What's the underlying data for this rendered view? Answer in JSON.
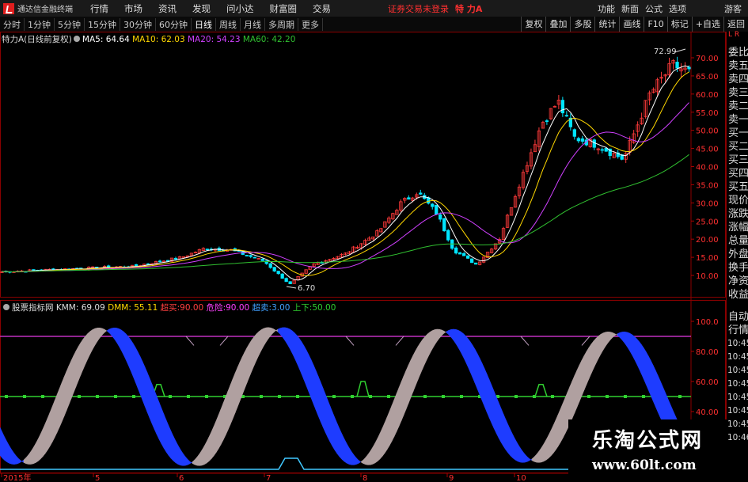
{
  "menubar": {
    "app_name": "通达信金融终端",
    "items": [
      "行情",
      "市场",
      "资讯",
      "发现",
      "问小达",
      "财富圈",
      "交易"
    ],
    "login_status": "证券交易未登录",
    "stock_name": "特 力A",
    "right_items": [
      "功能",
      "新面",
      "公式",
      "选项",
      "游客"
    ]
  },
  "periodbar": {
    "periods": [
      "分时",
      "1分钟",
      "5分钟",
      "15分钟",
      "30分钟",
      "60分钟",
      "日线",
      "周线",
      "月线",
      "多周期",
      "更多"
    ],
    "active": "日线",
    "tools": [
      "复权",
      "叠加",
      "多股",
      "统计",
      "画线",
      "F10",
      "标记",
      "+自选",
      "返回"
    ]
  },
  "legend_main": {
    "title": "特力A(日线前复权)",
    "ma5": "MA5: 64.64",
    "ma10": "MA10: 62.03",
    "ma20": "MA20: 54.23",
    "ma60": "MA60: 42.20"
  },
  "legend_ind": {
    "title": "股票指标网",
    "kmm": "KMM: 69.09",
    "dmm": "DMM: 55.11",
    "chaomai": "超买:",
    "chaomai_v": "90.00",
    "weixian": "危险:",
    "weixian_v": "90.00",
    "chaomai2": "超卖:",
    "chaomai2_v": "3.00",
    "shangxia": "上下:",
    "shangxia_v": "50.00"
  },
  "annotations": {
    "high": "72.99",
    "low": "6.70"
  },
  "price_axis": [
    "70.00",
    "65.00",
    "60.00",
    "55.00",
    "50.00",
    "45.00",
    "40.00",
    "35.00",
    "30.00",
    "25.00",
    "20.00",
    "15.00",
    "10.00"
  ],
  "ind_axis": [
    "100.0",
    "80.00",
    "60.00",
    "40.00"
  ],
  "date_axis": [
    "2015年",
    "5",
    "6",
    "7",
    "8",
    "9",
    "10"
  ],
  "right_panel": {
    "top": "L R",
    "items": [
      "委比",
      "卖五",
      "卖四",
      "卖三",
      "卖二",
      "卖一",
      "买一",
      "买二",
      "买三",
      "买四",
      "买五",
      "现价",
      "涨跌",
      "涨幅",
      "总量",
      "外盘",
      "换手",
      "净资",
      "收益",
      "自动",
      "行情"
    ],
    "times": [
      "10:45",
      "10:45",
      "10:45",
      "10:45",
      "10:45",
      "10:45",
      "10:45",
      "10:46"
    ]
  },
  "watermark": {
    "line1": "乐淘公式网",
    "line2": "www.60lt.com"
  },
  "colors": {
    "up": "#ff3a3a",
    "down": "#00e5ff",
    "ma5": "#ffffff",
    "ma10": "#ffd700",
    "ma20": "#d040ff",
    "ma60": "#30c030",
    "kmm": "#1e3cff",
    "dmm": "#b0a0a0",
    "mid": "#30d030",
    "top": "#c030c0"
  }
}
